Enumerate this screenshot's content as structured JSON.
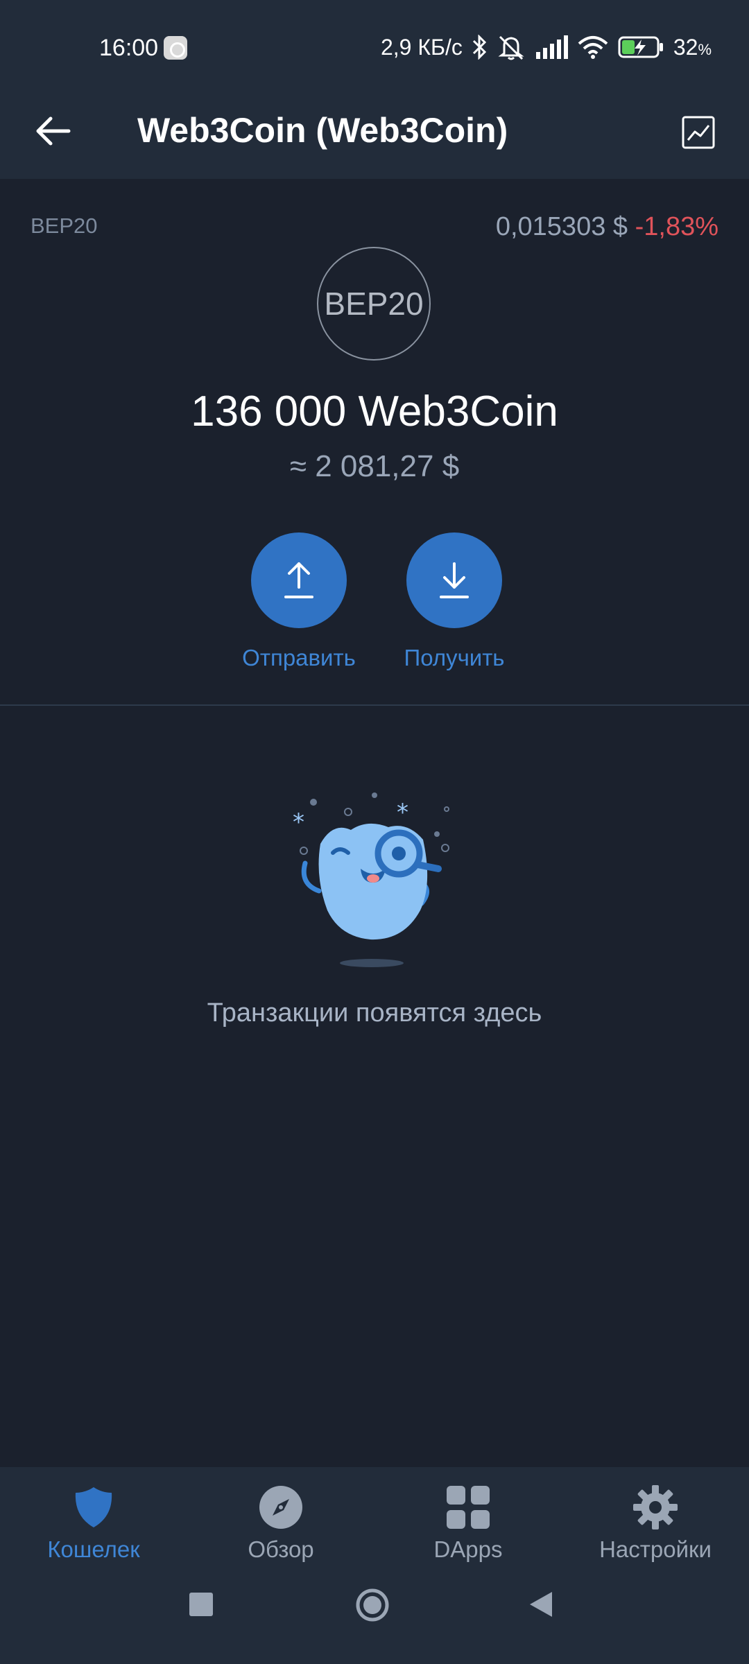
{
  "status_bar": {
    "time": "16:00",
    "net_speed": "2,9 КБ/с",
    "battery_value": "32",
    "battery_unit": "%"
  },
  "app_bar": {
    "title": "Web3Coin (Web3Coin)"
  },
  "token": {
    "network": "BEP20",
    "logo_text": "BEP20",
    "price": "0,015303 $",
    "change": "-1,83%",
    "balance": "136 000 Web3Coin",
    "fiat_balance": "≈ 2 081,27 $"
  },
  "actions": {
    "send_label": "Отправить",
    "receive_label": "Получить"
  },
  "empty_state": {
    "text": "Транзакции появятся здесь"
  },
  "bottom_nav": {
    "items": [
      {
        "label": "Кошелек",
        "icon": "shield-icon",
        "active": true
      },
      {
        "label": "Обзор",
        "icon": "compass-icon",
        "active": false
      },
      {
        "label": "DApps",
        "icon": "grid-icon",
        "active": false
      },
      {
        "label": "Настройки",
        "icon": "gear-icon",
        "active": false
      }
    ]
  },
  "colors": {
    "background": "#1b212d",
    "bar": "#222c3a",
    "accent": "#3073c4",
    "negative": "#e0535a"
  }
}
